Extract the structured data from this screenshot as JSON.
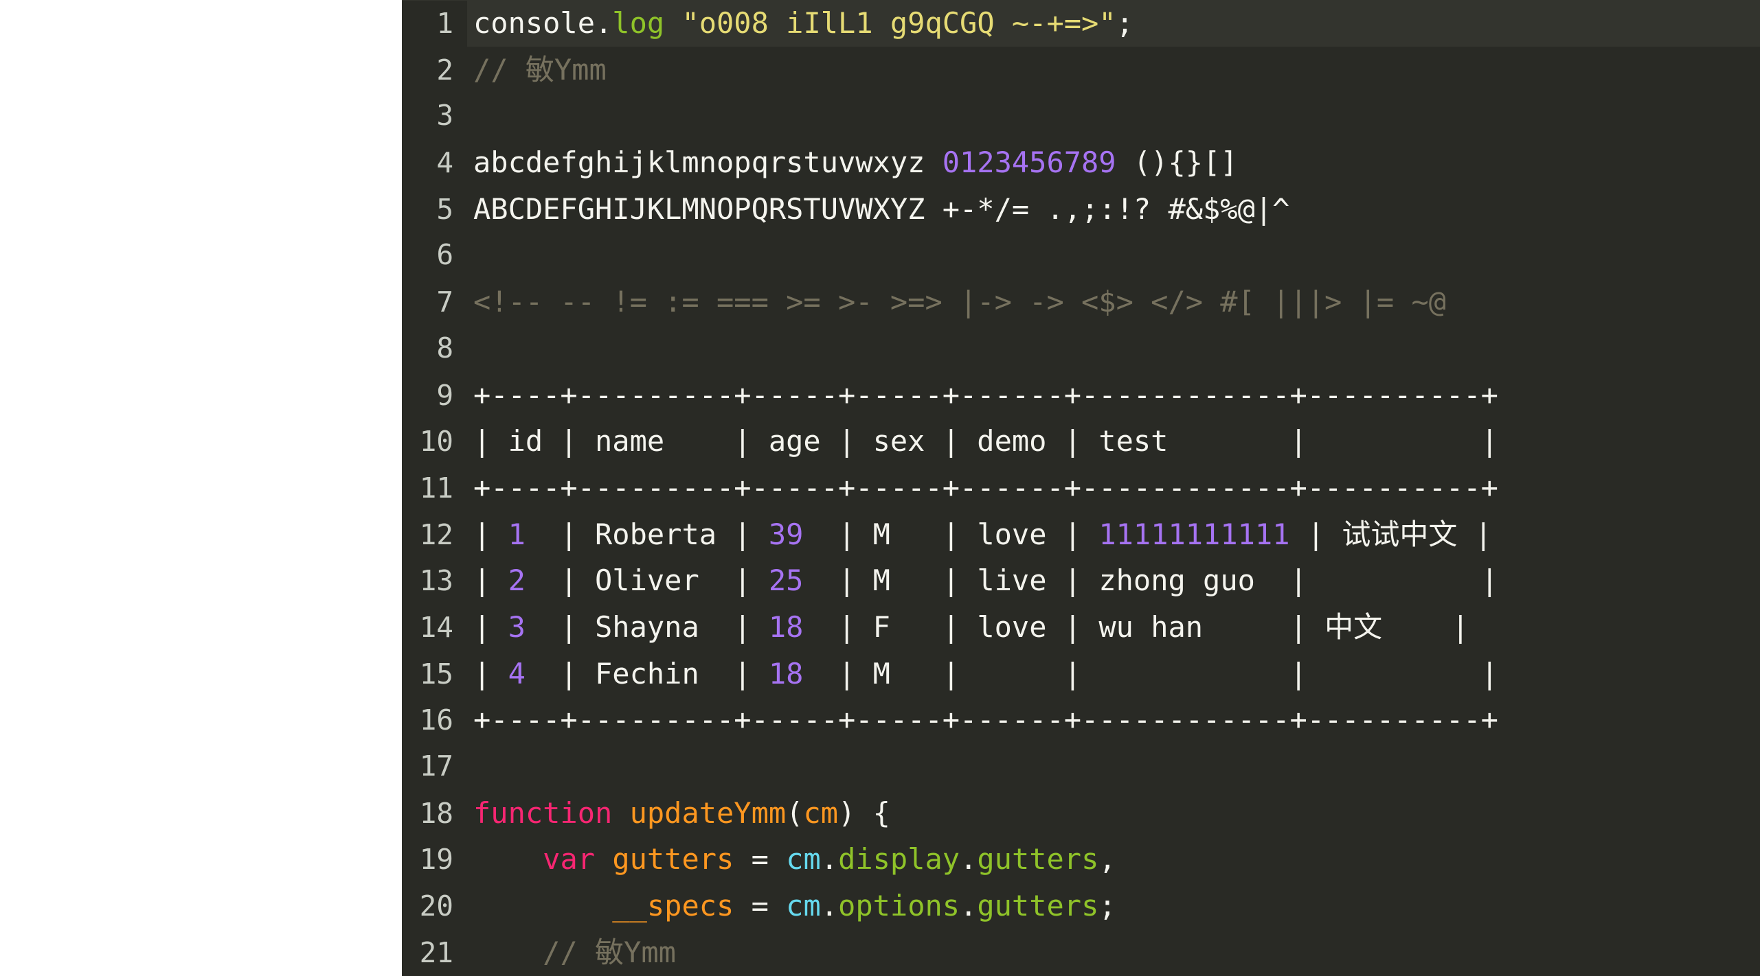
{
  "editor": {
    "background": "#292a25",
    "active_line_background": "#33342e",
    "gutter_text_color": "#c8ccc4",
    "default_text_color": "#f4f4ee",
    "active_line_number": 1,
    "colors": {
      "keyword": "#f62672",
      "string": "#e6db74",
      "comment": "#76715e",
      "number": "#a673f2",
      "function": "#fd9720",
      "variable": "#66d9ee",
      "property": "#8fc329",
      "plain": "#f4f4ee"
    },
    "lines": [
      {
        "number": "1",
        "active": true,
        "tokens": [
          {
            "t": "console.",
            "c": "plain"
          },
          {
            "t": "log",
            "c": "prop"
          },
          {
            "t": " ",
            "c": "plain"
          },
          {
            "t": "\"o008 iIlL1 g9qCGQ ~-+=>\"",
            "c": "string"
          },
          {
            "t": ";",
            "c": "plain"
          }
        ]
      },
      {
        "number": "2",
        "active": false,
        "tokens": [
          {
            "t": "// ",
            "c": "comment"
          },
          {
            "t": "敏",
            "c": "comment-cjk"
          },
          {
            "t": "Ymm",
            "c": "comment"
          }
        ]
      },
      {
        "number": "3",
        "active": false,
        "tokens": []
      },
      {
        "number": "4",
        "active": false,
        "tokens": [
          {
            "t": "abcdefghijklmnopqrstuvwxyz ",
            "c": "plain"
          },
          {
            "t": "0123456789",
            "c": "number"
          },
          {
            "t": " (){}[]",
            "c": "plain"
          }
        ]
      },
      {
        "number": "5",
        "active": false,
        "tokens": [
          {
            "t": "ABCDEFGHIJKLMNOPQRSTUVWXYZ +-*/= .,;:!? #&$%@|^",
            "c": "plain"
          }
        ]
      },
      {
        "number": "6",
        "active": false,
        "tokens": []
      },
      {
        "number": "7",
        "active": false,
        "tokens": [
          {
            "t": "<!-- -- != := === >= >- >=> |-> -> <$> </> #[ |||> |= ~@",
            "c": "comment"
          }
        ]
      },
      {
        "number": "8",
        "active": false,
        "tokens": []
      },
      {
        "number": "9",
        "active": false,
        "tokens": [
          {
            "t": "+----+---------+-----+-----+------+------------+----------+",
            "c": "plain"
          }
        ]
      },
      {
        "number": "10",
        "active": false,
        "tokens": [
          {
            "t": "| id | name    | age | sex | demo | test       |          |",
            "c": "plain"
          }
        ]
      },
      {
        "number": "11",
        "active": false,
        "tokens": [
          {
            "t": "+----+---------+-----+-----+------+------------+----------+",
            "c": "plain"
          }
        ]
      },
      {
        "number": "12",
        "active": false,
        "tokens": [
          {
            "t": "| ",
            "c": "plain"
          },
          {
            "t": "1",
            "c": "number"
          },
          {
            "t": "  | Roberta | ",
            "c": "plain"
          },
          {
            "t": "39",
            "c": "number"
          },
          {
            "t": "  | M   | love | ",
            "c": "plain"
          },
          {
            "t": "11111111111",
            "c": "number"
          },
          {
            "t": " | ",
            "c": "plain"
          },
          {
            "t": "试试中文",
            "c": "plain-cjk"
          },
          {
            "t": " |",
            "c": "plain"
          }
        ]
      },
      {
        "number": "13",
        "active": false,
        "tokens": [
          {
            "t": "| ",
            "c": "plain"
          },
          {
            "t": "2",
            "c": "number"
          },
          {
            "t": "  | Oliver  | ",
            "c": "plain"
          },
          {
            "t": "25",
            "c": "number"
          },
          {
            "t": "  | M   | live | zhong guo  |          |",
            "c": "plain"
          }
        ]
      },
      {
        "number": "14",
        "active": false,
        "tokens": [
          {
            "t": "| ",
            "c": "plain"
          },
          {
            "t": "3",
            "c": "number"
          },
          {
            "t": "  | Shayna  | ",
            "c": "plain"
          },
          {
            "t": "18",
            "c": "number"
          },
          {
            "t": "  | F   | love | wu han     | ",
            "c": "plain"
          },
          {
            "t": "中文",
            "c": "plain-cjk"
          },
          {
            "t": "    |",
            "c": "plain"
          }
        ]
      },
      {
        "number": "15",
        "active": false,
        "tokens": [
          {
            "t": "| ",
            "c": "plain"
          },
          {
            "t": "4",
            "c": "number"
          },
          {
            "t": "  | Fechin  | ",
            "c": "plain"
          },
          {
            "t": "18",
            "c": "number"
          },
          {
            "t": "  | M   |      |            |          |",
            "c": "plain"
          }
        ]
      },
      {
        "number": "16",
        "active": false,
        "tokens": [
          {
            "t": "+----+---------+-----+-----+------+------------+----------+",
            "c": "plain"
          }
        ]
      },
      {
        "number": "17",
        "active": false,
        "tokens": []
      },
      {
        "number": "18",
        "active": false,
        "tokens": [
          {
            "t": "function",
            "c": "keyword"
          },
          {
            "t": " ",
            "c": "plain"
          },
          {
            "t": "updateYmm",
            "c": "func"
          },
          {
            "t": "(",
            "c": "plain"
          },
          {
            "t": "cm",
            "c": "param"
          },
          {
            "t": ") {",
            "c": "plain"
          }
        ]
      },
      {
        "number": "19",
        "active": false,
        "tokens": [
          {
            "t": "    ",
            "c": "plain"
          },
          {
            "t": "var",
            "c": "keyword"
          },
          {
            "t": " ",
            "c": "plain"
          },
          {
            "t": "gutters",
            "c": "func"
          },
          {
            "t": " = ",
            "c": "plain"
          },
          {
            "t": "cm",
            "c": "var"
          },
          {
            "t": ".",
            "c": "plain"
          },
          {
            "t": "display",
            "c": "prop"
          },
          {
            "t": ".",
            "c": "plain"
          },
          {
            "t": "gutters",
            "c": "prop"
          },
          {
            "t": ",",
            "c": "plain"
          }
        ]
      },
      {
        "number": "20",
        "active": false,
        "tokens": [
          {
            "t": "        ",
            "c": "plain"
          },
          {
            "t": "__specs",
            "c": "func"
          },
          {
            "t": " = ",
            "c": "plain"
          },
          {
            "t": "cm",
            "c": "var"
          },
          {
            "t": ".",
            "c": "plain"
          },
          {
            "t": "options",
            "c": "prop"
          },
          {
            "t": ".",
            "c": "plain"
          },
          {
            "t": "gutters",
            "c": "prop"
          },
          {
            "t": ";",
            "c": "plain"
          }
        ]
      },
      {
        "number": "21",
        "active": false,
        "tokens": [
          {
            "t": "    ",
            "c": "plain"
          },
          {
            "t": "// ",
            "c": "comment"
          },
          {
            "t": "敏",
            "c": "comment-cjk"
          },
          {
            "t": "Ymm",
            "c": "comment"
          }
        ]
      }
    ]
  }
}
